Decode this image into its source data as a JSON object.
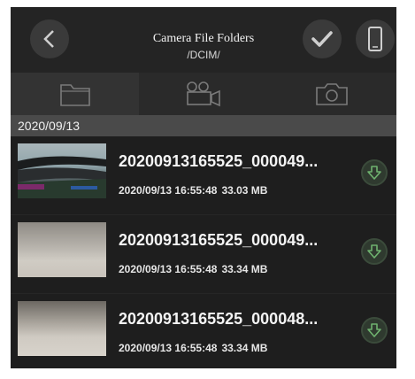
{
  "header": {
    "title": "Camera File Folders",
    "path": "/DCIM/",
    "back_icon": "chevron-left-icon",
    "check_icon": "check-icon",
    "device_icon": "phone-icon"
  },
  "tabs": [
    {
      "icon": "folder-icon",
      "active": true
    },
    {
      "icon": "video-camera-icon",
      "active": false
    },
    {
      "icon": "photo-camera-icon",
      "active": false
    }
  ],
  "date_group": "2020/09/13",
  "files": [
    {
      "name": "20200913165525_000049...",
      "datetime": "2020/09/13 16:55:48",
      "size": "33.03 MB",
      "action_icon": "download-icon"
    },
    {
      "name": "20200913165525_000049...",
      "datetime": "2020/09/13 16:55:48",
      "size": "33.34 MB",
      "action_icon": "download-icon"
    },
    {
      "name": "20200913165525_000048...",
      "datetime": "2020/09/13 16:55:48",
      "size": "33.34 MB",
      "action_icon": "download-icon"
    }
  ],
  "colors": {
    "background": "#1f1f1f",
    "header": "#242424",
    "date_bar": "#4a4a4a",
    "download_accent": "#6fb26f"
  }
}
